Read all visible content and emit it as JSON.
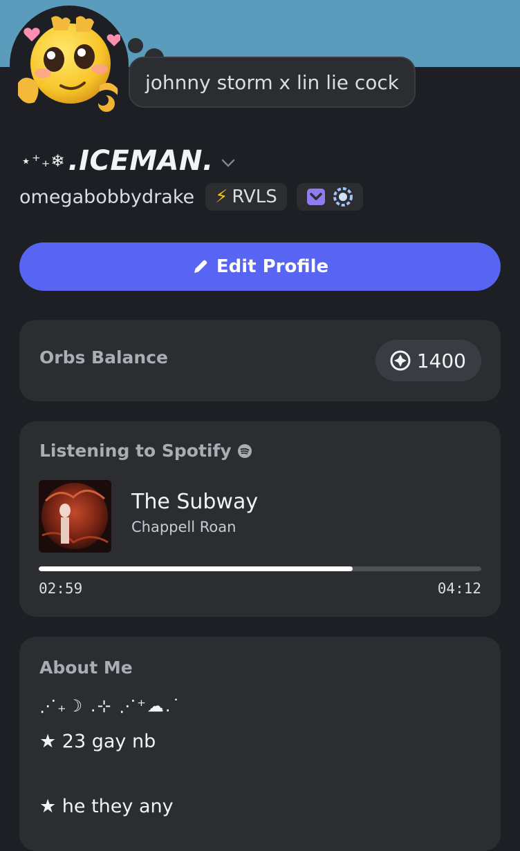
{
  "profile": {
    "status_text": "johnny storm x lin lie cock",
    "display_name_prefix": "⋆⁺₊❄",
    "display_name": ".ICEMAN.",
    "username": "omegabobbydrake",
    "server_tag": "RVLS"
  },
  "actions": {
    "edit_profile_label": "Edit Profile"
  },
  "orbs": {
    "label": "Orbs Balance",
    "amount": "1400"
  },
  "spotify": {
    "header": "Listening to Spotify",
    "track": "The Subway",
    "artist": "Chappell Roan",
    "elapsed": "02:59",
    "duration": "04:12",
    "progress_fraction": 0.71
  },
  "about": {
    "title": "About Me",
    "line1": "⋰₊☽ .⊹ ⋰⁺☁.˙",
    "line2": "★ 23 gay nb",
    "line3": "★ he they any"
  },
  "colors": {
    "banner": "#5b9cbd",
    "accent": "#5865f2",
    "background": "#1e1f24",
    "card": "#2b2d31"
  },
  "icons": {
    "status": "moon-idle-icon",
    "edit": "pencil-icon",
    "orbs": "orb-icon",
    "spotify": "spotify-icon",
    "badges": [
      "nitro-badge-icon",
      "boost-badge-icon"
    ]
  }
}
